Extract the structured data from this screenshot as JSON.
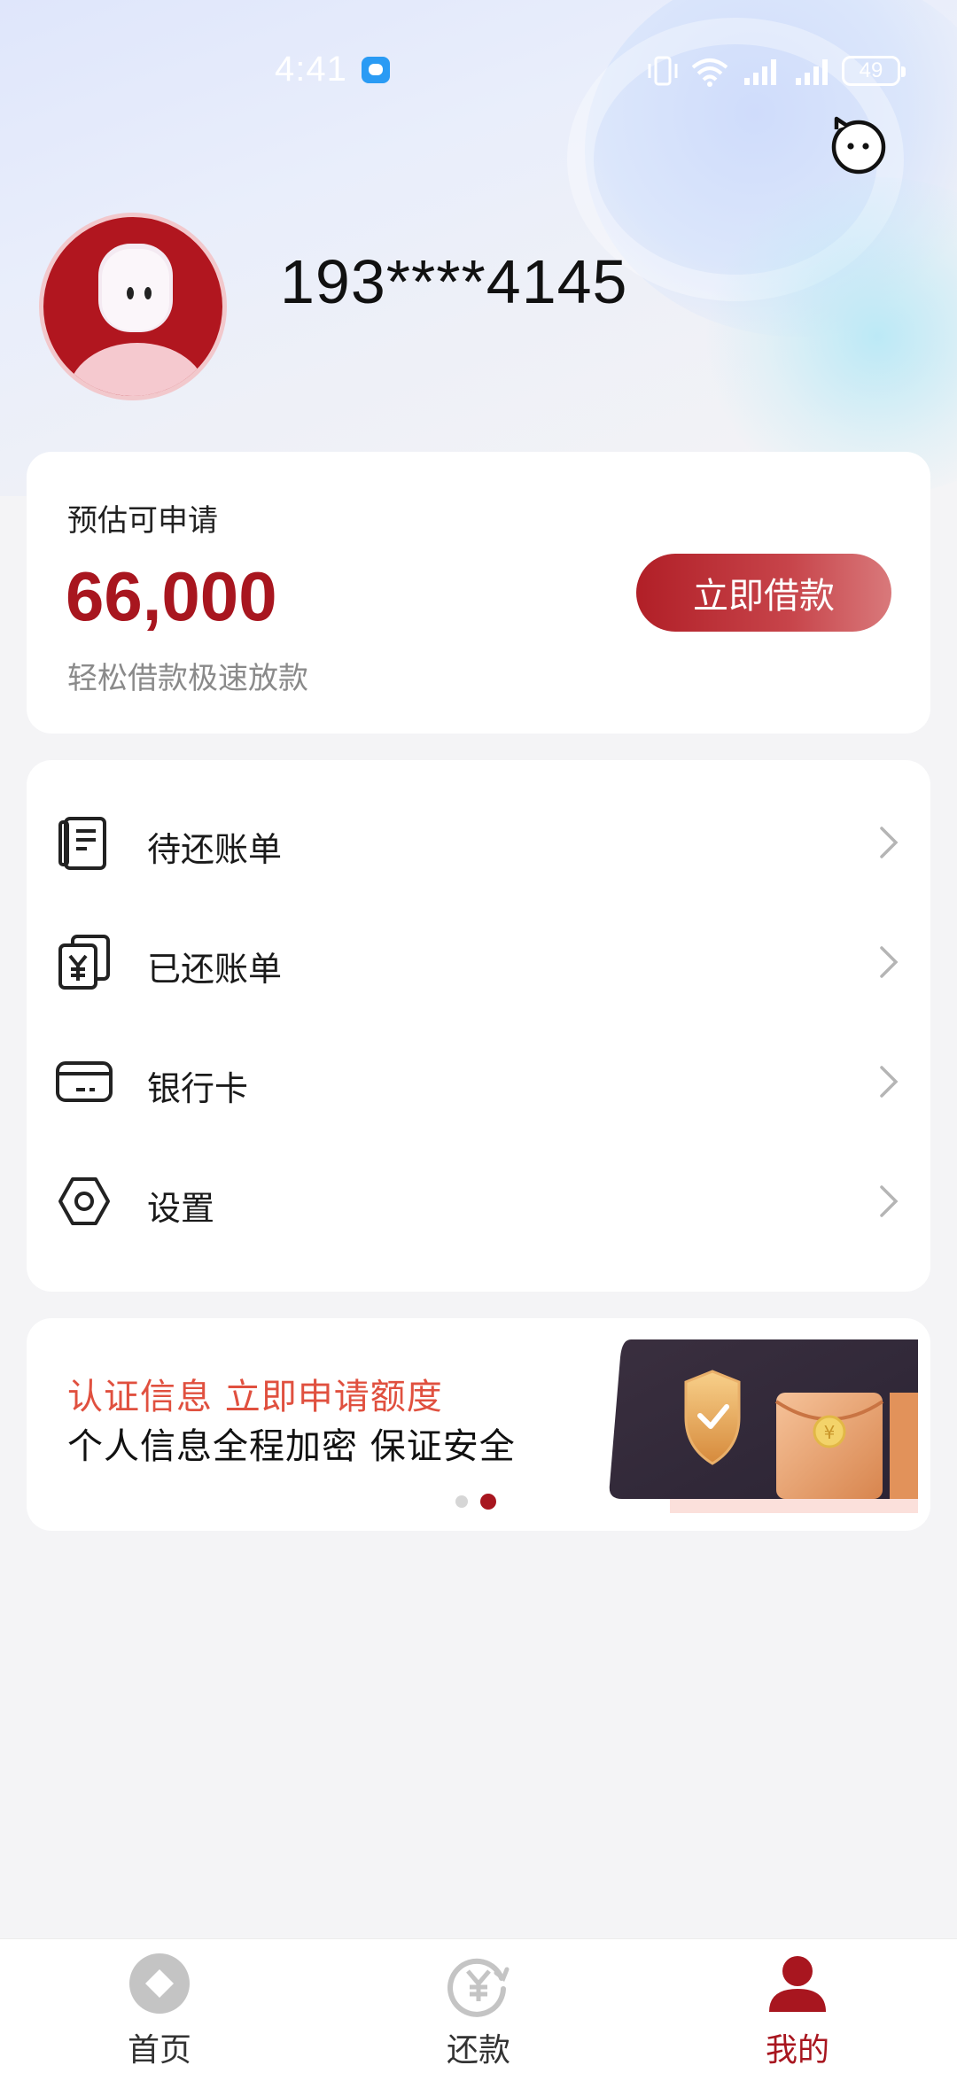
{
  "status_bar": {
    "time": "4:41",
    "battery": "49"
  },
  "profile": {
    "phone": "193****4145"
  },
  "loan_card": {
    "label": "预估可申请",
    "amount": "66,000",
    "subtitle": "轻松借款极速放款",
    "button_label": "立即借款"
  },
  "menu": {
    "items": [
      {
        "label": "待还账单",
        "icon": "pending-bill-icon"
      },
      {
        "label": "已还账单",
        "icon": "paid-bill-icon"
      },
      {
        "label": "银行卡",
        "icon": "bank-card-icon"
      },
      {
        "label": "设置",
        "icon": "settings-icon"
      }
    ]
  },
  "banner": {
    "title": "认证信息 立即申请额度",
    "subtitle": "个人信息全程加密 保证安全",
    "page_count": 2,
    "active_page": 2
  },
  "tab_bar": {
    "tabs": [
      {
        "label": "首页",
        "icon": "home-icon",
        "active": false
      },
      {
        "label": "还款",
        "icon": "repay-icon",
        "active": false
      },
      {
        "label": "我的",
        "icon": "profile-icon",
        "active": true
      }
    ]
  },
  "colors": {
    "brand": "#a8161f",
    "banner_accent": "#e0503f",
    "background": "#f4f4f6"
  }
}
